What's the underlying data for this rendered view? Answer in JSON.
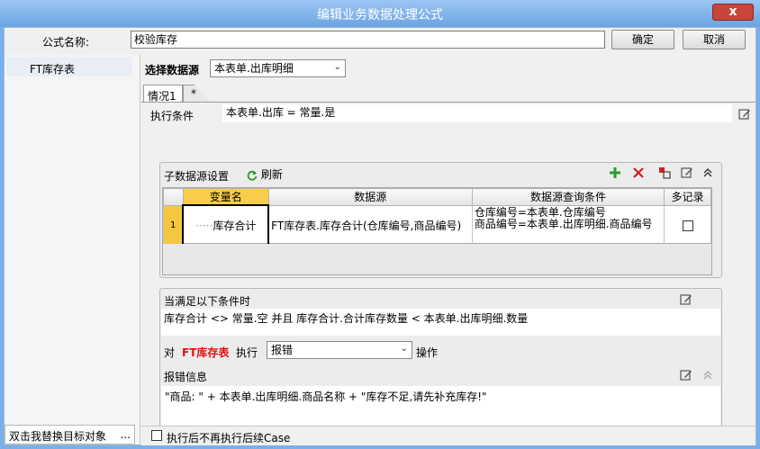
{
  "window": {
    "title": "编辑业务数据处理公式",
    "close_label": "x"
  },
  "formula": {
    "name_label": "公式名称:",
    "name_value": "校验库存",
    "ok_label": "确定",
    "cancel_label": "取消"
  },
  "sidebar": {
    "items": [
      {
        "label": "FT库存表"
      }
    ],
    "bottom_hint": "双击我替换目标对象",
    "bottom_more": "..."
  },
  "datasource": {
    "label": "选择数据源",
    "selected": "本表单.出库明细"
  },
  "tabs": [
    {
      "label": "情况1"
    },
    {
      "label": "*"
    }
  ],
  "condition": {
    "label": "执行条件",
    "value": "本表单.出库 = 常量.是"
  },
  "subsource": {
    "title": "子数据源设置",
    "refresh_label": "刷新",
    "columns": [
      "变量名",
      "数据源",
      "数据源查询条件",
      "多记录"
    ],
    "rows": [
      {
        "num": "1",
        "var_name": "库存合计",
        "source": "FT库存表.库存合计(仓库编号,商品编号)",
        "query_line1": "仓库编号=本表单.仓库编号",
        "query_line2": "商品编号=本表单.出库明细.商品编号",
        "multi": false
      }
    ]
  },
  "rule": {
    "when_label": "当满足以下条件时",
    "expression": "库存合计 <> 常量.空 并且 库存合计.合计库存数量 < 本表单.出库明细.数量",
    "to_label": "对",
    "target": "FT库存表",
    "exec_label": "执行",
    "action": "报错",
    "op_label": "操作",
    "error_label": "报错信息",
    "error_text": "\"商品: \" + 本表单.出库明细.商品名称 + \"库存不足,请先补充库存!\""
  },
  "footer": {
    "checkbox_label": "执行后不再执行后续Case",
    "checked": false
  },
  "colors": {
    "title_bar": "#7ab0ea",
    "target_red": "#e01010",
    "add_green": "#2a9d2a",
    "delete_red": "#d22020",
    "header_selected": "#f9cd49"
  }
}
